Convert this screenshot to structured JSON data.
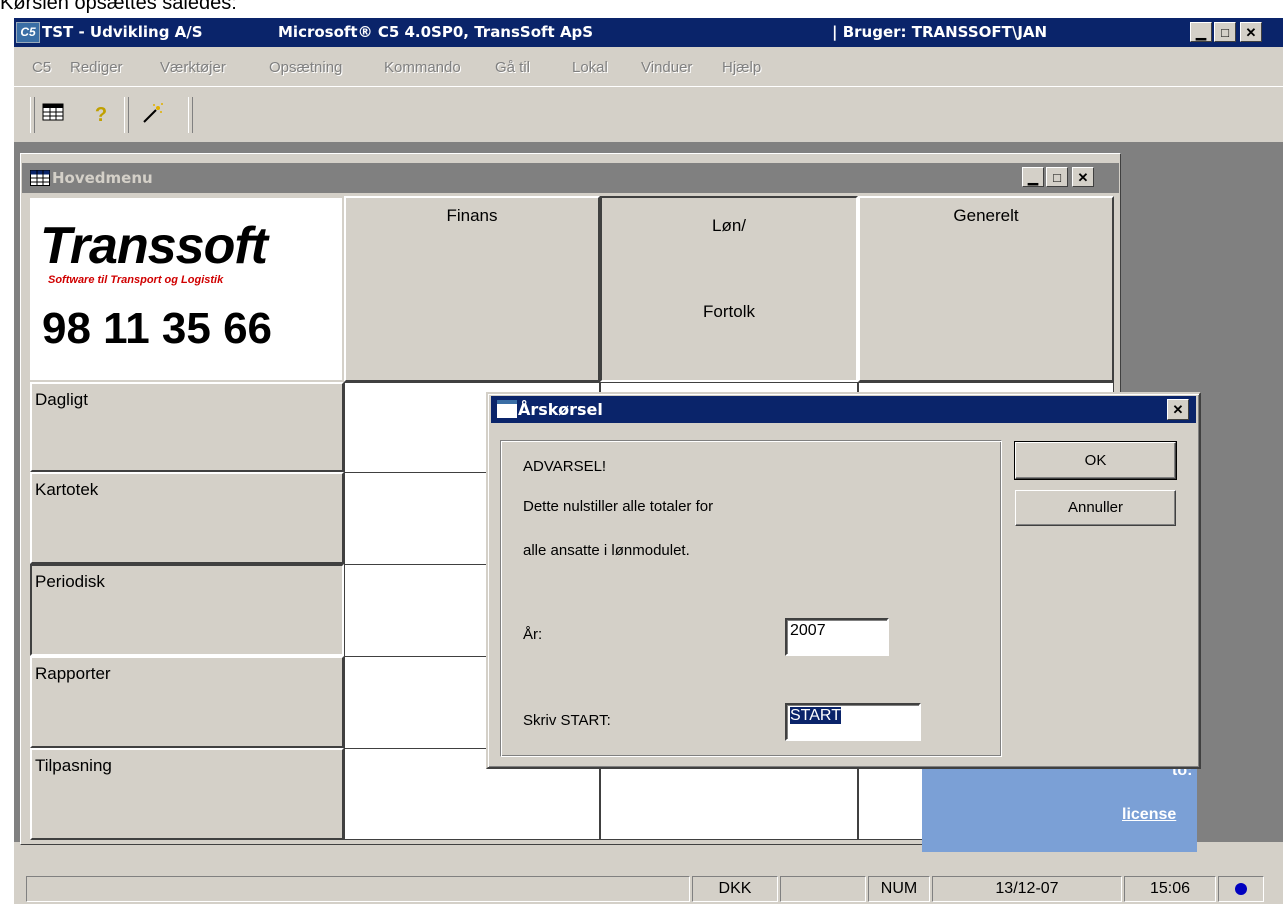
{
  "caption": "Kørslen opsættes således:",
  "app": {
    "title_company": "TST - Udvikling A/S",
    "title_product": "Microsoft® C5 4.0SP0, TransSoft ApS",
    "title_user": "| Bruger: TRANSSOFT\\JAN",
    "logo_text": "C5"
  },
  "menu": [
    "C5",
    "Rediger",
    "Værktøjer",
    "Opsætning",
    "Kommando",
    "Gå til",
    "Lokal",
    "Vinduer",
    "Hjælp"
  ],
  "toolbar": {
    "icons": [
      "table-icon",
      "help-icon",
      "wand-icon"
    ]
  },
  "hovedmenu": {
    "title": "Hovedmenu",
    "logo": {
      "brand": "Transsoft",
      "subtitle": "Software til Transport og Logistik",
      "phone": "98 11 35 66"
    },
    "columns": [
      "Finans",
      "Løn/",
      "Generelt"
    ],
    "column_2_line2": "Fortolk",
    "rows": [
      "Dagligt",
      "Kartotek",
      "Periodisk",
      "Rapporter",
      "Tilpasning"
    ]
  },
  "background_panel": {
    "line1": "l to:",
    "line2": "license"
  },
  "dialog": {
    "title": "Årskørsel",
    "warning": "ADVARSEL!",
    "line1": "Dette nulstiller alle totaler for",
    "line2": "alle ansatte i lønmodulet.",
    "year_label": "År:",
    "year_value": "2007",
    "start_label": "Skriv START:",
    "start_value": "START",
    "ok_label": "OK",
    "cancel_label": "Annuller"
  },
  "statusbar": {
    "currency": "DKK",
    "num": "NUM",
    "date": "13/12-07",
    "time": "15:06"
  }
}
